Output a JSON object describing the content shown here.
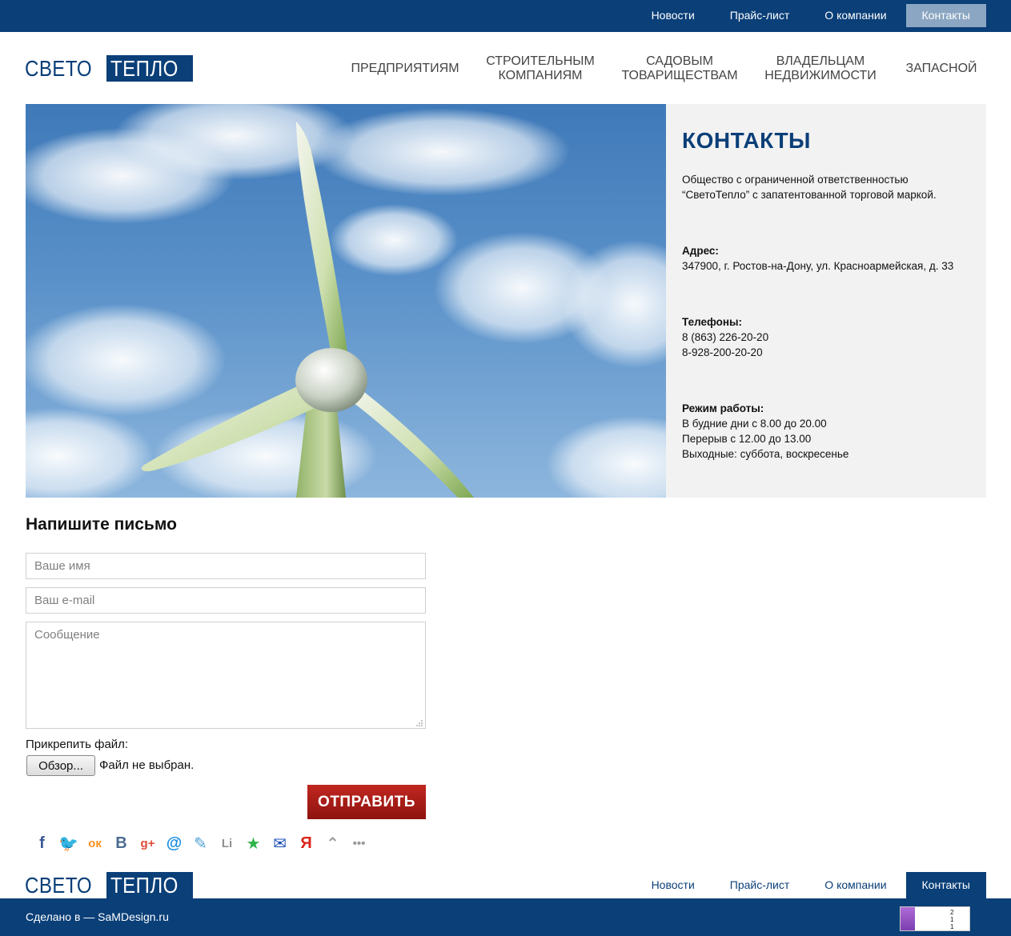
{
  "top_nav": [
    {
      "label": "Новости",
      "active": false
    },
    {
      "label": "Прайс-лист",
      "active": false
    },
    {
      "label": "О компании",
      "active": false
    },
    {
      "label": "Контакты",
      "active": true
    }
  ],
  "logo": {
    "part1": "СВЕТО",
    "part2": "ТЕПЛО"
  },
  "main_nav": [
    {
      "label": "ПРЕДПРИЯТИЯМ"
    },
    {
      "label": "СТРОИТЕЛЬНЫМ КОМПАНИЯМ"
    },
    {
      "label": "САДОВЫМ ТОВАРИЩЕСТВАМ"
    },
    {
      "label": "ВЛАДЕЛЬЦАМ НЕДВИЖИМОСТИ"
    },
    {
      "label": "ЗАПАСНОЙ"
    }
  ],
  "contacts": {
    "title": "КОНТАКТЫ",
    "intro": "Общество с ограниченной ответственностью “СветоТепло” с запатентованной торговой маркой.",
    "address_label": "Адрес:",
    "address": "347900, г. Ростов-на-Дону, ул. Красноармейская, д. 33",
    "phones_label": "Телефоны:",
    "phone1": "8 (863) 226-20-20",
    "phone2": "8-928-200-20-20",
    "hours_label": "Режим работы:",
    "hours1": "В будние дни с 8.00 до 20.00",
    "hours2": "Перерыв с 12.00 до 13.00",
    "hours3": "Выходные: суббота, воскресенье"
  },
  "form": {
    "title": "Напишите письмо",
    "name_placeholder": "Ваше имя",
    "email_placeholder": "Ваш e-mail",
    "message_placeholder": "Сообщение",
    "attach_label": "Прикрепить файл:",
    "browse_label": "Обзор...",
    "file_status": "Файл не выбран.",
    "submit_label": "ОТПРАВИТЬ"
  },
  "share_icons": [
    {
      "name": "facebook-icon",
      "glyph": "f",
      "color": "#3b5998"
    },
    {
      "name": "twitter-icon",
      "glyph": "🐦",
      "color": "#1da1f2"
    },
    {
      "name": "odnoklassniki-icon",
      "glyph": "ок",
      "color": "#f7931e"
    },
    {
      "name": "vkontakte-icon",
      "glyph": "B",
      "color": "#4c6c91"
    },
    {
      "name": "google-plus-icon",
      "glyph": "g+",
      "color": "#dd4b39"
    },
    {
      "name": "mailru-icon",
      "glyph": "@",
      "color": "#168de2"
    },
    {
      "name": "livejournal-icon",
      "glyph": "✎",
      "color": "#4b9fd5"
    },
    {
      "name": "linkedin-icon",
      "glyph": "Li",
      "color": "#8f8f8f"
    },
    {
      "name": "favorites-star-icon",
      "glyph": "★",
      "color": "#2fb44a"
    },
    {
      "name": "email-icon",
      "glyph": "✉",
      "color": "#1c50b8"
    },
    {
      "name": "yandex-icon",
      "glyph": "Я",
      "color": "#d9251b"
    },
    {
      "name": "scroll-up-icon",
      "glyph": "⌃",
      "color": "#9a9a9a"
    },
    {
      "name": "more-icon",
      "glyph": "•••",
      "color": "#9a9a9a"
    }
  ],
  "footer_nav": [
    {
      "label": "Новости",
      "active": false
    },
    {
      "label": "Прайс-лист",
      "active": false
    },
    {
      "label": "О компании",
      "active": false
    },
    {
      "label": "Контакты",
      "active": true
    }
  ],
  "footer": {
    "made_by": "Сделано в — SaMDesign.ru"
  },
  "counter": {
    "values": [
      "2",
      "1",
      "1"
    ]
  },
  "colors": {
    "brand": "#0a3f78",
    "submit": "#b01e18",
    "panel": "#f2f2f2"
  }
}
